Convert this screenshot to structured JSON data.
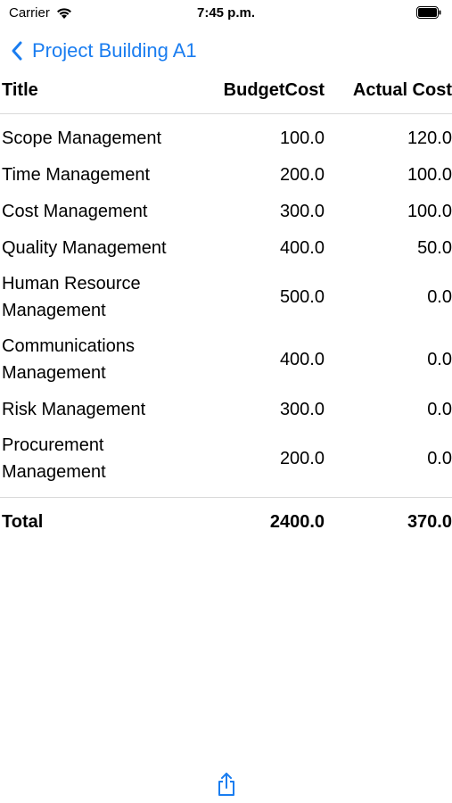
{
  "status_bar": {
    "carrier": "Carrier",
    "time": "7:45 p.m.",
    "wifi_icon": "wifi-icon",
    "battery_icon": "battery-icon"
  },
  "nav": {
    "back_label": "Project Building A1",
    "back_icon": "chevron-left-icon",
    "accent_color": "#1a7df0"
  },
  "table": {
    "headers": {
      "title": "Title",
      "budget": "BudgetCost",
      "actual": "Actual Cost"
    },
    "rows": [
      {
        "title": "Scope Management",
        "budget": "100.0",
        "actual": "120.0"
      },
      {
        "title": "Time Management",
        "budget": "200.0",
        "actual": "100.0"
      },
      {
        "title": "Cost Management",
        "budget": "300.0",
        "actual": "100.0"
      },
      {
        "title": "Quality Management",
        "budget": "400.0",
        "actual": "50.0"
      },
      {
        "title": "Human Resource Management",
        "budget": "500.0",
        "actual": "0.0"
      },
      {
        "title": "Communications Management",
        "budget": "400.0",
        "actual": "0.0"
      },
      {
        "title": "Risk Management",
        "budget": "300.0",
        "actual": "0.0"
      },
      {
        "title": "Procurement Management",
        "budget": "200.0",
        "actual": "0.0"
      }
    ],
    "total": {
      "title": "Total",
      "budget": "2400.0",
      "actual": "370.0"
    }
  },
  "toolbar": {
    "share_icon": "share-icon"
  }
}
